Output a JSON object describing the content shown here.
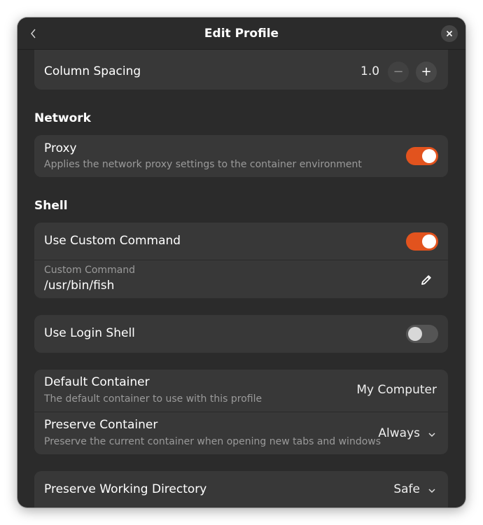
{
  "header": {
    "back_icon": "back-chevron-icon",
    "title": "Edit Profile",
    "close_icon": "close-icon"
  },
  "column_spacing": {
    "label": "Column Spacing",
    "value": "1.0",
    "decrement_label": "−",
    "increment_label": "+"
  },
  "network": {
    "section_title": "Network",
    "proxy": {
      "label": "Proxy",
      "description": "Applies the network proxy settings to the container environment",
      "enabled": true
    }
  },
  "shell": {
    "section_title": "Shell",
    "use_custom_command": {
      "label": "Use Custom Command",
      "enabled": true
    },
    "custom_command": {
      "label": "Custom Command",
      "value": "/usr/bin/fish",
      "edit_icon": "pencil-icon"
    },
    "use_login_shell": {
      "label": "Use Login Shell",
      "enabled": false
    }
  },
  "container": {
    "default_container": {
      "label": "Default Container",
      "description": "The default container to use with this profile",
      "value": "My Computer"
    },
    "preserve_container": {
      "label": "Preserve Container",
      "description": "Preserve the current container when opening new tabs and windows",
      "value": "Always"
    }
  },
  "working_directory": {
    "label": "Preserve Working Directory",
    "value": "Safe"
  },
  "colors": {
    "accent": "#e2531e",
    "window_bg": "#2b2b2b",
    "card_bg": "#383838"
  }
}
